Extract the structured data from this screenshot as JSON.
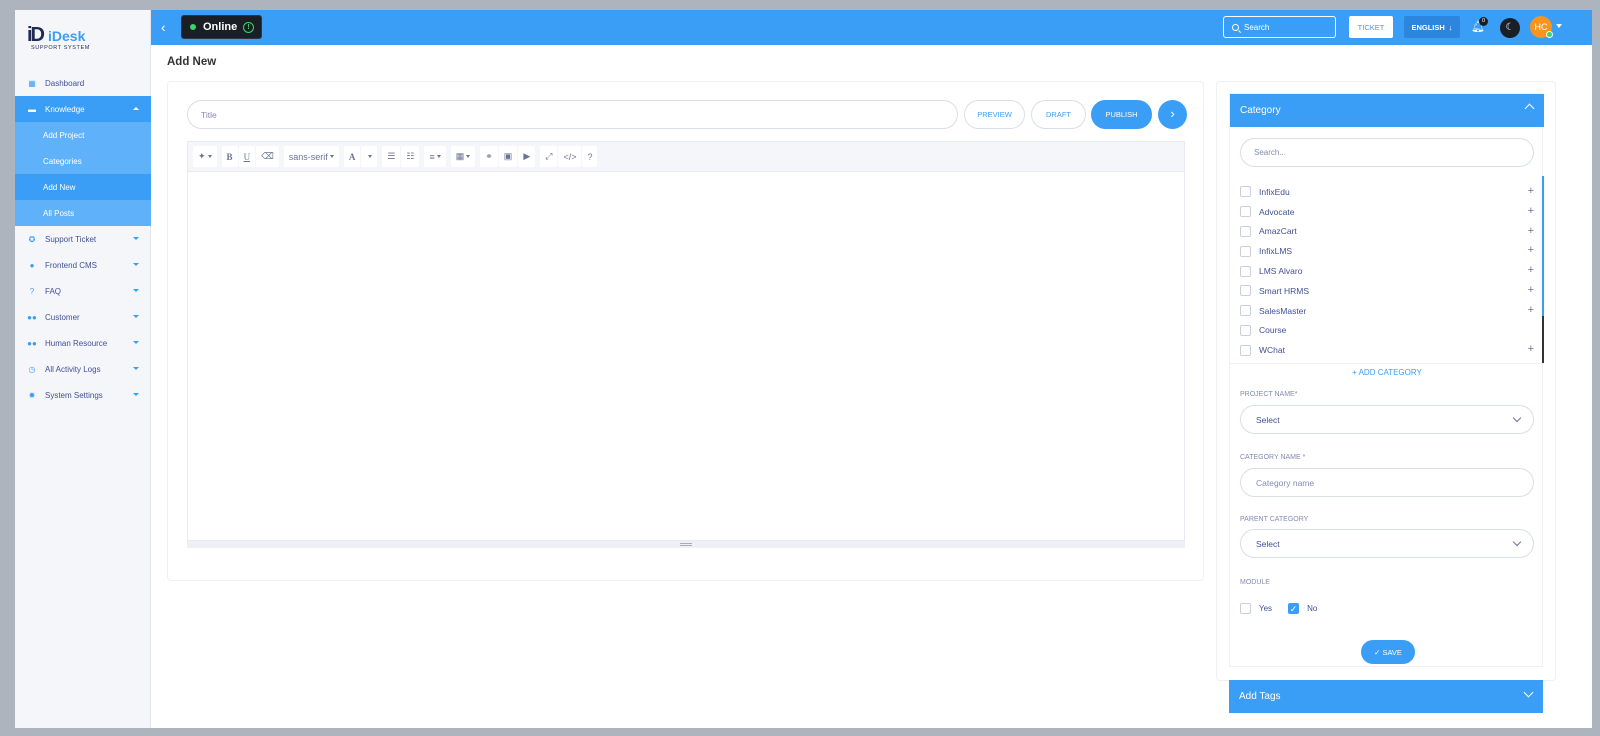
{
  "brand": {
    "mark": "iD",
    "name": "iDesk",
    "tagline": "SUPPORT SYSTEM"
  },
  "sidebar": {
    "items": [
      {
        "label": "Dashboard",
        "icon": "grid-icon"
      },
      {
        "label": "Knowledge",
        "icon": "book-icon",
        "expanded": true,
        "children": [
          "Add Project",
          "Categories",
          "Add New",
          "All Posts"
        ]
      },
      {
        "label": "Support Ticket",
        "icon": "lifebuoy-icon"
      },
      {
        "label": "Frontend CMS",
        "icon": "user-icon"
      },
      {
        "label": "FAQ",
        "icon": "question-icon"
      },
      {
        "label": "Customer",
        "icon": "users-icon"
      },
      {
        "label": "Human Resource",
        "icon": "people-icon"
      },
      {
        "label": "All Activity Logs",
        "icon": "clock-icon"
      },
      {
        "label": "System Settings",
        "icon": "gear-icon"
      }
    ]
  },
  "topbar": {
    "status": "Online",
    "search_placeholder": "Search",
    "ticket_label": "TICKET",
    "language": "ENGLISH",
    "notifications": "0",
    "avatar_initials": "HC"
  },
  "page": {
    "title": "Add New"
  },
  "editor": {
    "title_placeholder": "Title",
    "preview_label": "PREVIEW",
    "draft_label": "DRAFT",
    "publish_label": "PUBLISH",
    "font_family": "sans-serif"
  },
  "category_panel": {
    "header": "Category",
    "search_placeholder": "Search...",
    "categories": [
      {
        "name": "InfixEdu",
        "has_children": true
      },
      {
        "name": "Advocate",
        "has_children": true
      },
      {
        "name": "AmazCart",
        "has_children": true
      },
      {
        "name": "InfixLMS",
        "has_children": true
      },
      {
        "name": "LMS Alvaro",
        "has_children": true
      },
      {
        "name": "Smart HRMS",
        "has_children": true
      },
      {
        "name": "SalesMaster",
        "has_children": true
      },
      {
        "name": "Course",
        "has_children": false
      },
      {
        "name": "WChat",
        "has_children": true
      }
    ],
    "add_category_label": "ADD CATEGORY",
    "project_name_label": "PROJECT NAME*",
    "project_name_value": "Select",
    "category_name_label": "CATEGORY NAME *",
    "category_name_placeholder": "Category name",
    "parent_category_label": "PARENT CATEGORY",
    "parent_category_value": "Select",
    "module_label": "MODULE",
    "module_yes": "Yes",
    "module_no": "No",
    "module_selected": "No",
    "save_label": "✓ SAVE"
  },
  "tags_panel": {
    "header": "Add Tags"
  },
  "colors": {
    "accent": "#3a9ef7",
    "text": "#415094",
    "online": "#3ed26a"
  }
}
